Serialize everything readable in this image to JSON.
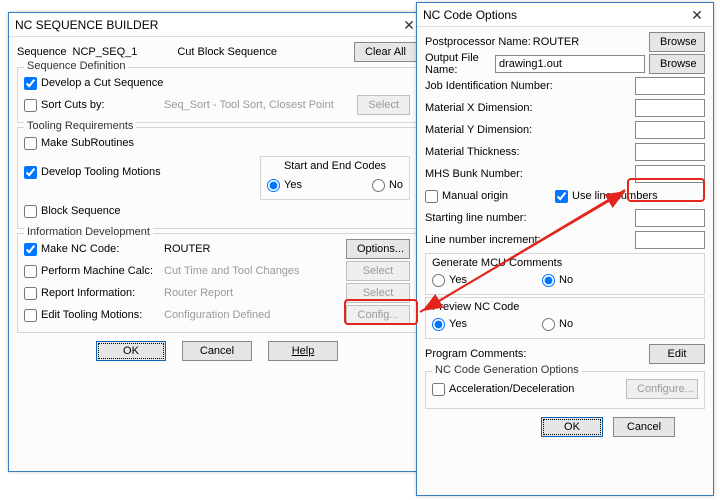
{
  "win1": {
    "title": "NC SEQUENCE BUILDER",
    "seqLabel": "Sequence",
    "seqName": "NCP_SEQ_1",
    "seqDesc": "Cut Block Sequence",
    "clearAll": "Clear All",
    "grpSeqDef": "Sequence Definition",
    "developCut": "Develop a Cut Sequence",
    "sortCuts": "Sort Cuts by:",
    "sortHint": "Seq_Sort - Tool Sort, Closest Point",
    "select": "Select",
    "grpTooling": "Tooling Requirements",
    "makeSub": "Make SubRoutines",
    "devToolMotions": "Develop Tooling Motions",
    "startEnd": "Start and End Codes",
    "yes": "Yes",
    "no": "No",
    "blockSeq": "Block Sequence",
    "grpInfo": "Information Development",
    "makeNC": "Make NC Code:",
    "router": "ROUTER",
    "options": "Options...",
    "perfMachine": "Perform Machine Calc:",
    "perfHint": "Cut Time and Tool Changes",
    "reportInfo": "Report Information:",
    "reportHint": "Router Report",
    "editTool": "Edit Tooling Motions:",
    "editHint": "Configuration Defined",
    "config": "Config...",
    "ok": "OK",
    "cancel": "Cancel",
    "help": "Help"
  },
  "win2": {
    "title": "NC Code Options",
    "postName": "Postprocessor Name:",
    "postVal": "ROUTER",
    "browse": "Browse",
    "outFile": "Output File Name:",
    "outVal": "drawing1.out",
    "jobId": "Job Identification Number:",
    "matX": "Material X Dimension:",
    "matY": "Material Y Dimension:",
    "matThick": "Material Thickness:",
    "mhs": "MHS Bunk Number:",
    "manualOrigin": "Manual origin",
    "useLineNum": "Use line numbers",
    "startLine": "Starting line number:",
    "lineInc": "Line number increment:",
    "genMCU": "Generate MCU Comments",
    "yes": "Yes",
    "no": "No",
    "preview": "Preview NC Code",
    "progComments": "Program Comments:",
    "edit": "Edit",
    "ncGenOpts": "NC Code Generation Options",
    "accel": "Acceleration/Deceleration",
    "configure": "Configure...",
    "ok": "OK",
    "cancel": "Cancel"
  }
}
